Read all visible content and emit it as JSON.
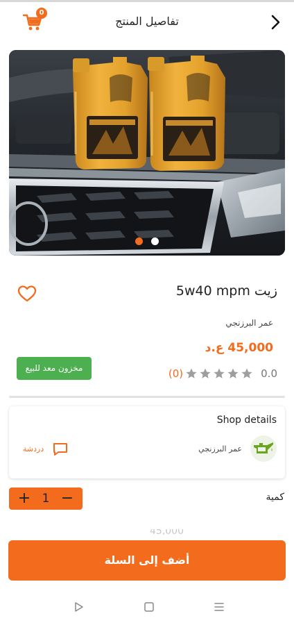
{
  "header": {
    "title": "تفاصيل المنتج",
    "cart_badge_count": "0"
  },
  "gallery": {
    "slide_count": 2,
    "active_slide": 1,
    "dot_active_color": "#f36b1c",
    "dot_inactive_color": "#ffffff"
  },
  "product": {
    "name": "زيت 5w40 mpm",
    "seller": "عمر البرزنجي",
    "price": "45,000 ع.د",
    "stock_status": "مخزون معد للبيع",
    "rating_value": "0.0",
    "rating_stars": 0,
    "rating_max": 5,
    "rating_count": "(0)"
  },
  "shop": {
    "title": "Shop details",
    "name": "عمر البرزنجي",
    "chat_label": "دردشة"
  },
  "quantity": {
    "label": "كمية",
    "value": "1",
    "plus_symbol": "+",
    "minus_symbol": "−"
  },
  "actions": {
    "add_to_cart_label": "أضف إلى السلة"
  },
  "icons": {
    "back": "chevron-right-icon",
    "cart": "shopping-cart-icon",
    "favorite": "heart-outline-icon",
    "star": "star-icon",
    "chat": "chat-bubble-icon",
    "shop_logo": "oil-can-icon",
    "nav_back": "triangle-back-icon",
    "nav_home": "square-home-icon",
    "nav_recents": "menu-lines-icon"
  },
  "colors": {
    "accent": "#f36b1c",
    "stock_green": "#4caf50",
    "star_empty": "#9e9e9e"
  }
}
